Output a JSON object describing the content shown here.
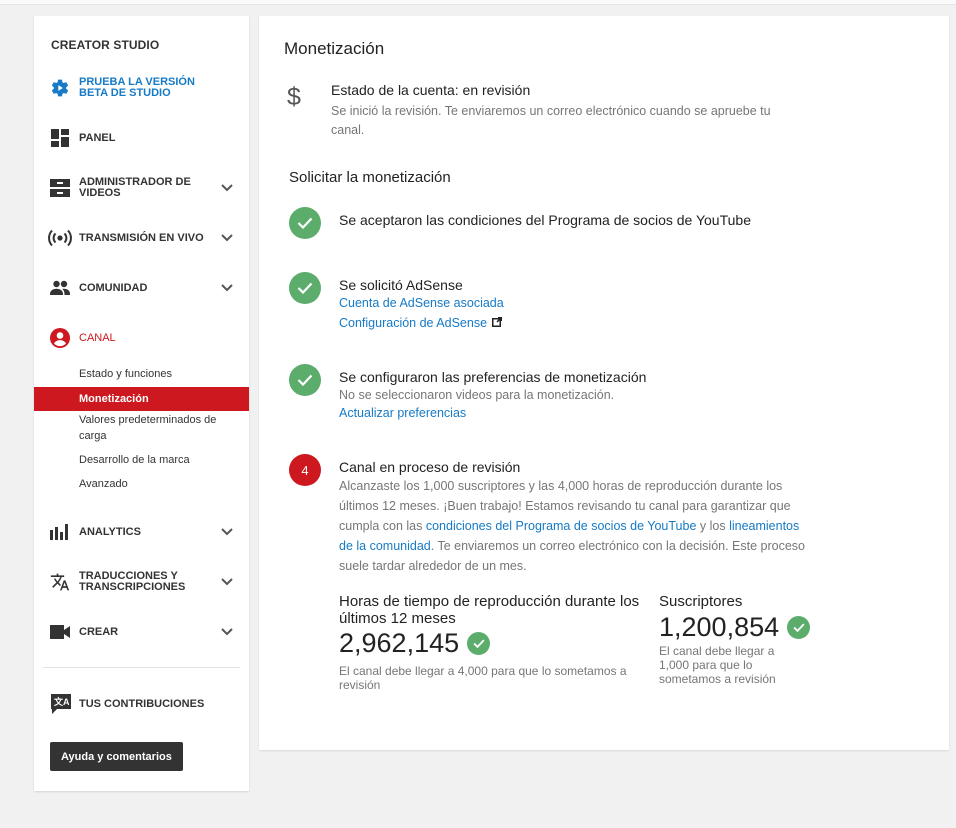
{
  "sidebar": {
    "title": "CREATOR STUDIO",
    "beta": "PRUEBA LA VERSIÓN BETA DE STUDIO",
    "panel": "PANEL",
    "videos": "ADMINISTRADOR DE VIDEOS",
    "live": "TRANSMISIÓN EN VIVO",
    "community": "COMUNIDAD",
    "channel": "CANAL",
    "channel_sub": [
      "Estado y funciones",
      "Monetización",
      "Valores predeterminados de carga",
      "Desarrollo de la marca",
      "Avanzado"
    ],
    "analytics": "ANALYTICS",
    "translations": "TRADUCCIONES Y TRANSCRIPCIONES",
    "create": "CREAR",
    "contributions": "TUS CONTRIBUCIONES",
    "help_button": "Ayuda y comentarios"
  },
  "main": {
    "title": "Monetización",
    "account_status": "Estado de la cuenta: en revisión",
    "account_desc": "Se inició la revisión. Te enviaremos un correo electrónico cuando se apruebe tu canal.",
    "section_title": "Solicitar la monetización",
    "step1": {
      "title": "Se aceptaron las condiciones del Programa de socios de YouTube"
    },
    "step2": {
      "title": "Se solicitó AdSense",
      "link1": "Cuenta de AdSense asociada",
      "link2": "Configuración de AdSense"
    },
    "step3": {
      "title": "Se configuraron las preferencias de monetización",
      "desc": "No se seleccionaron videos para la monetización.",
      "link": "Actualizar preferencias"
    },
    "step4": {
      "number": "4",
      "title": "Canal en proceso de revisión",
      "desc_a": "Alcanzaste los 1,000 suscriptores y las 4,000 horas de reproducción durante los últimos 12 meses. ¡Buen trabajo! Estamos revisando tu canal para garantizar que cumpla con las ",
      "link_a": "condiciones del Programa de socios de YouTube",
      "desc_b": " y los ",
      "link_b": "lineamientos de la comunidad",
      "desc_c": ". Te enviaremos un correo electrónico con la decisión. Este proceso suele tardar alrededor de un mes."
    },
    "stats": {
      "hours_label": "Horas de tiempo de reproducción durante los últimos 12 meses",
      "hours_value": "2,962,145",
      "hours_note": "El canal debe llegar a 4,000 para que lo sometamos a revisión",
      "subs_label": "Suscriptores",
      "subs_value": "1,200,854",
      "subs_note": "El canal debe llegar a 1,000 para que lo sometamos a revisión"
    }
  },
  "colors": {
    "accent_red": "#cc181e",
    "link_blue": "#167ac6",
    "check_green": "#5cad6c"
  }
}
